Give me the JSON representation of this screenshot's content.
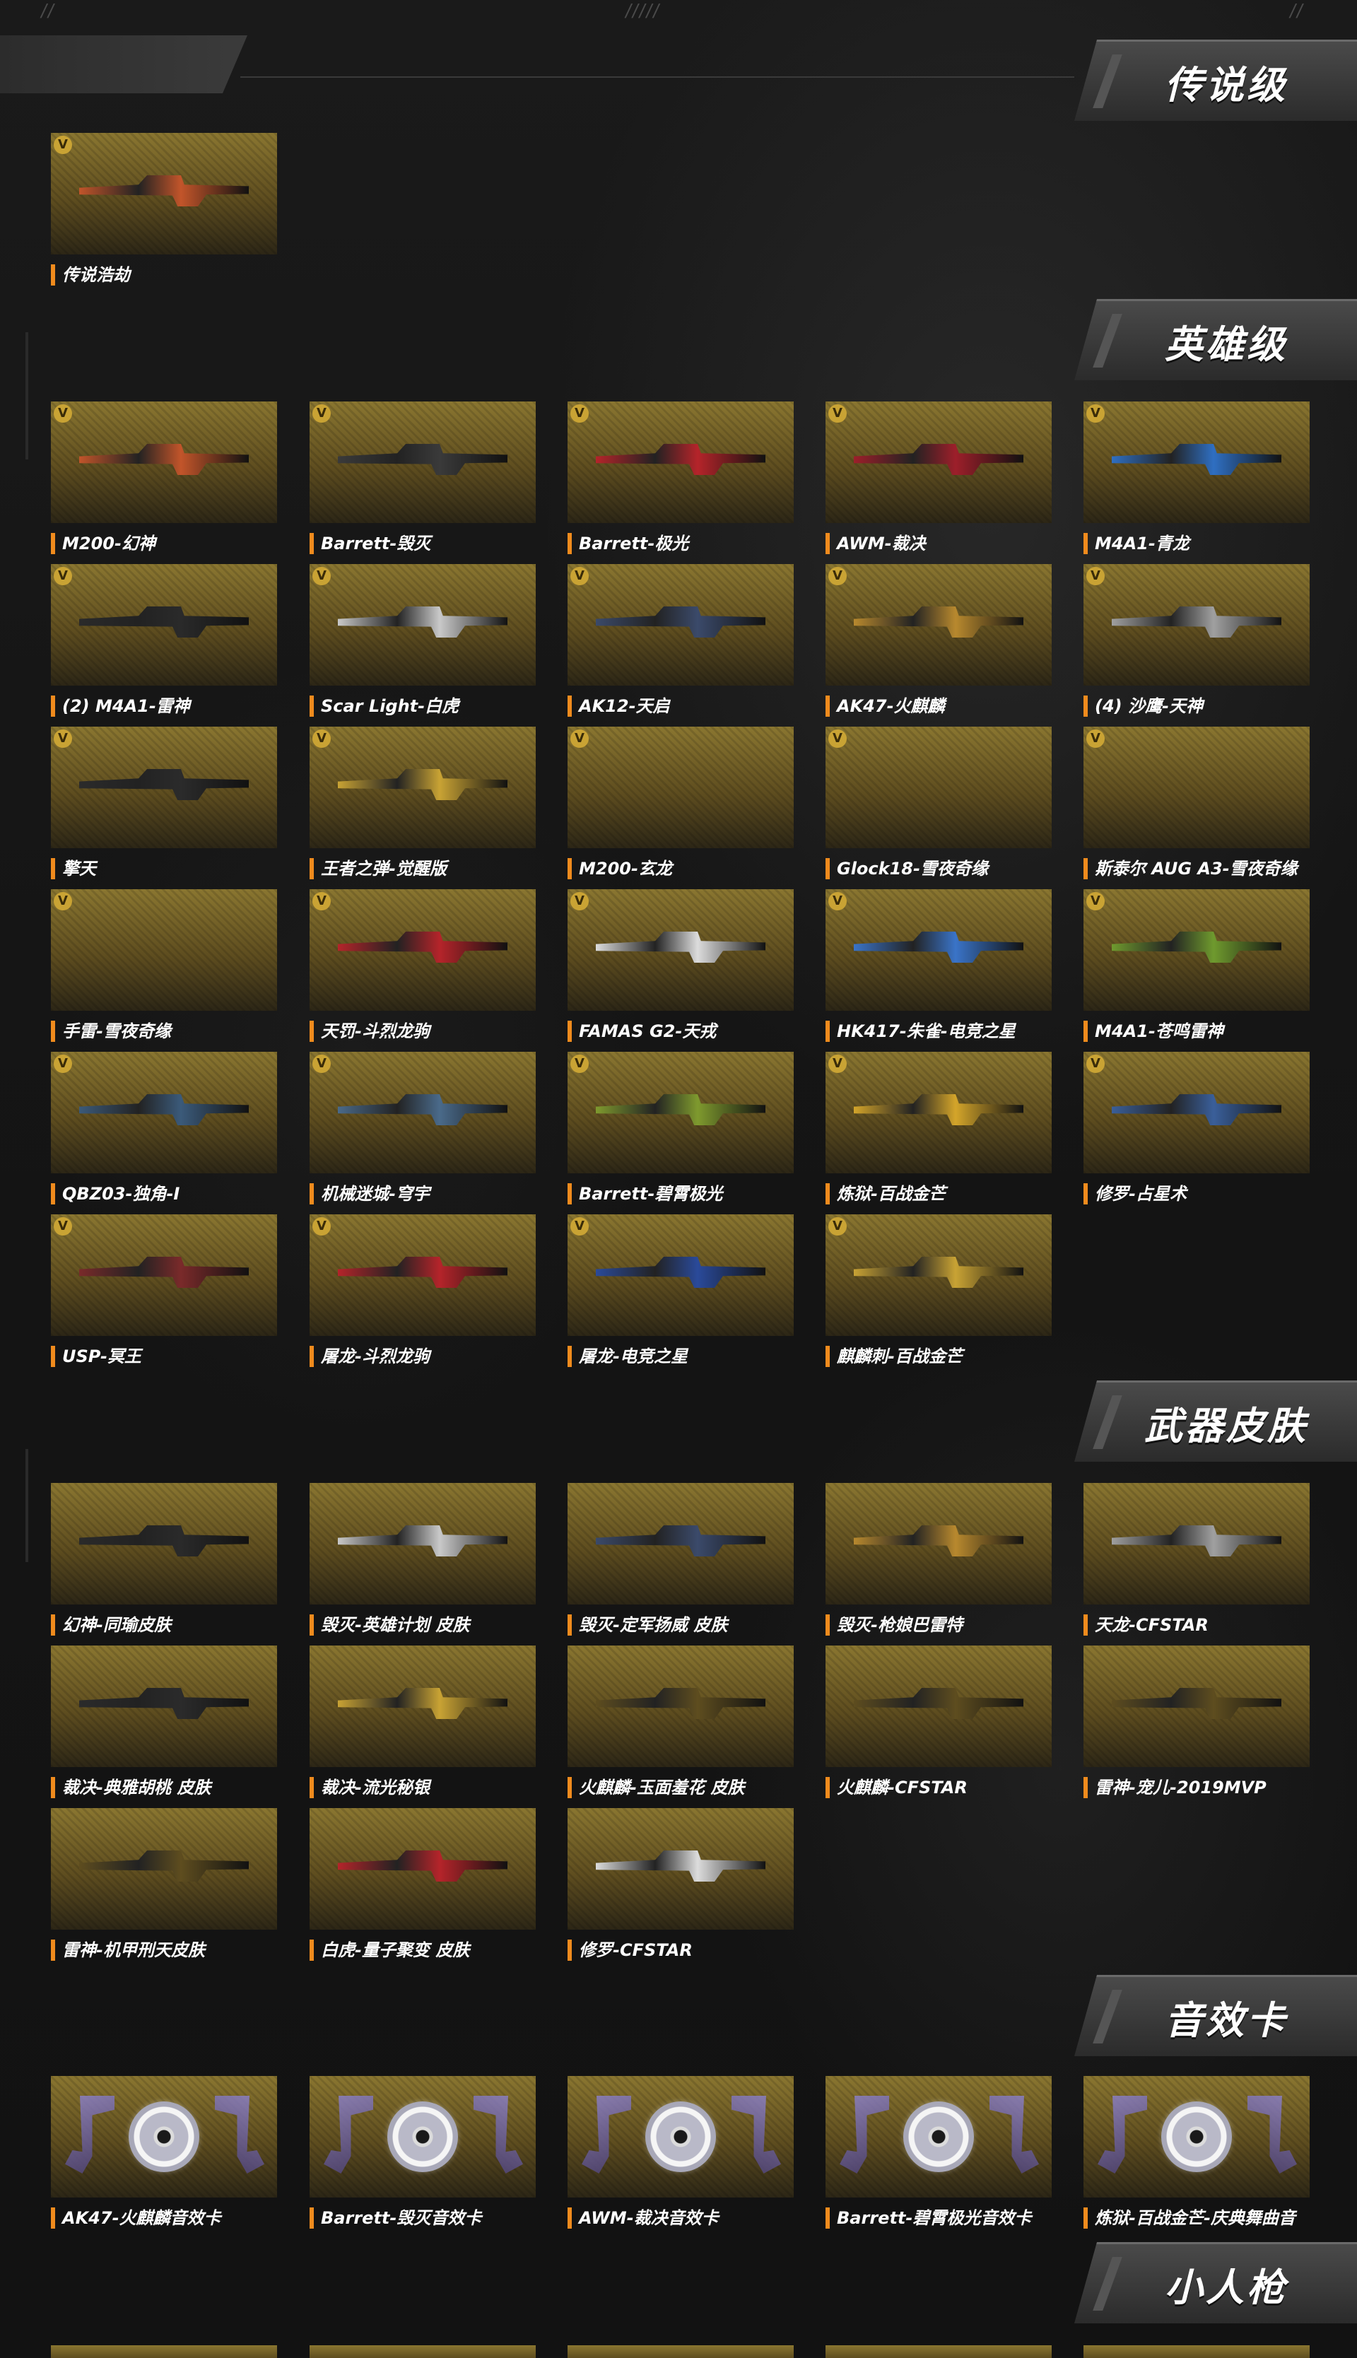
{
  "top_marks": [
    "//",
    "/////",
    "//"
  ],
  "sections": {
    "legend": {
      "title": "传说级",
      "items": [
        {
          "label": "传说浩劫"
        }
      ]
    },
    "hero": {
      "title": "英雄级",
      "items": [
        {
          "label": "M200-幻神"
        },
        {
          "label": "Barrett-毁灭"
        },
        {
          "label": "Barrett-极光"
        },
        {
          "label": "AWM-裁决"
        },
        {
          "label": "M4A1-青龙"
        },
        {
          "label": "(2) M4A1-雷神"
        },
        {
          "label": "Scar Light-白虎"
        },
        {
          "label": "AK12-天启"
        },
        {
          "label": "AK47-火麒麟"
        },
        {
          "label": "(4) 沙鹰-天神"
        },
        {
          "label": "擎天"
        },
        {
          "label": "王者之弹-觉醒版"
        },
        {
          "label": "M200-玄龙"
        },
        {
          "label": "Glock18-雪夜奇缘"
        },
        {
          "label": "斯泰尔 AUG A3-雪夜奇缘"
        },
        {
          "label": "手雷-雪夜奇缘"
        },
        {
          "label": "天罚-斗烈龙驹"
        },
        {
          "label": "FAMAS G2-天戎"
        },
        {
          "label": "HK417-朱雀-电竞之星"
        },
        {
          "label": "M4A1-苍鸣雷神"
        },
        {
          "label": "QBZ03-独角-I"
        },
        {
          "label": "机械迷城-穹宇"
        },
        {
          "label": "Barrett-碧霄极光"
        },
        {
          "label": "炼狱-百战金芒"
        },
        {
          "label": "修罗-占星术"
        },
        {
          "label": "USP-冥王"
        },
        {
          "label": "屠龙-斗烈龙驹"
        },
        {
          "label": "屠龙-电竞之星"
        },
        {
          "label": "麒麟刺-百战金芒"
        }
      ]
    },
    "skins": {
      "title": "武器皮肤",
      "items": [
        {
          "label": "幻神-同瑜皮肤"
        },
        {
          "label": "毁灭-英雄计划 皮肤"
        },
        {
          "label": "毁灭-定军扬威 皮肤"
        },
        {
          "label": "毁灭-枪娘巴雷特"
        },
        {
          "label": "天龙-CFSTAR"
        },
        {
          "label": "裁决-典雅胡桃 皮肤"
        },
        {
          "label": "裁决-流光秘银"
        },
        {
          "label": "火麒麟-玉面羞花 皮肤"
        },
        {
          "label": "火麒麟-CFSTAR"
        },
        {
          "label": "雷神-宠儿-2019MVP"
        },
        {
          "label": "雷神-机甲刑天皮肤"
        },
        {
          "label": "白虎-量子聚变 皮肤"
        },
        {
          "label": "修罗-CFSTAR"
        }
      ]
    },
    "sound": {
      "title": "音效卡",
      "items": [
        {
          "label": "AK47-火麒麟音效卡"
        },
        {
          "label": "Barrett-毁灭音效卡"
        },
        {
          "label": "AWM-裁决音效卡"
        },
        {
          "label": "Barrett-碧霄极光音效卡"
        },
        {
          "label": "炼狱-百战金芒-庆典舞曲音"
        }
      ]
    },
    "mini": {
      "title": "小人枪"
    }
  },
  "colors": {
    "accent": "#f08b1d",
    "badge": "#c9a334",
    "card_gold": "#8a7630"
  }
}
